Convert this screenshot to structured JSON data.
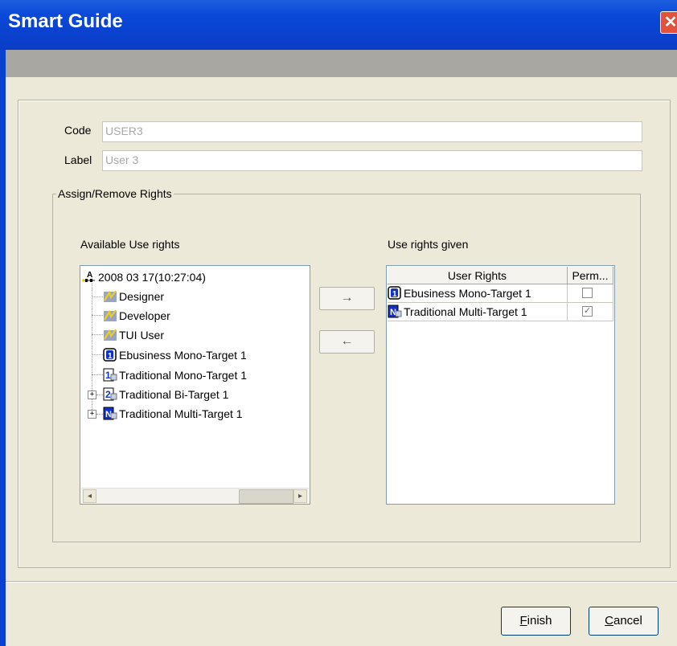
{
  "window": {
    "title": "Smart Guide",
    "close_glyph": "✕"
  },
  "form": {
    "code_label": "Code",
    "code_value": "USER3",
    "label_label": "Label",
    "label_value": "User 3"
  },
  "rights_group": {
    "legend": "Assign/Remove Rights",
    "available_title": "Available Use rights",
    "given_title": "Use rights given"
  },
  "tree": {
    "root": {
      "label": "2008 03 17(10:27:04)",
      "icon": "repository-icon"
    },
    "items": [
      {
        "label": "Designer",
        "icon": "role-icon",
        "expandable": false
      },
      {
        "label": "Developer",
        "icon": "role-icon",
        "expandable": false
      },
      {
        "label": "TUI User",
        "icon": "role-icon",
        "expandable": false
      },
      {
        "label": "Ebusiness Mono-Target 1",
        "icon": "mono-target-icon",
        "expandable": false
      },
      {
        "label": "Traditional Mono-Target 1",
        "icon": "traditional-mono-icon",
        "expandable": false
      },
      {
        "label": "Traditional Bi-Target 1",
        "icon": "bi-target-icon",
        "expandable": true
      },
      {
        "label": "Traditional Multi-Target 1",
        "icon": "multi-target-icon",
        "expandable": true
      }
    ]
  },
  "buttons": {
    "add_glyph": "→",
    "remove_glyph": "←",
    "finish_mnemonic": "F",
    "finish_rest": "inish",
    "cancel_mnemonic": "C",
    "cancel_rest": "ancel"
  },
  "given_table": {
    "columns": [
      "User Rights",
      "Perm..."
    ],
    "rows": [
      {
        "label": "Ebusiness Mono-Target 1",
        "icon": "mono-target-icon",
        "perm": false
      },
      {
        "label": "Traditional Multi-Target 1",
        "icon": "multi-target-icon",
        "perm": true
      }
    ]
  },
  "colors": {
    "titlebar": "#0a48d8",
    "close": "#e2523a",
    "dialog_bg": "#ece9d8"
  }
}
